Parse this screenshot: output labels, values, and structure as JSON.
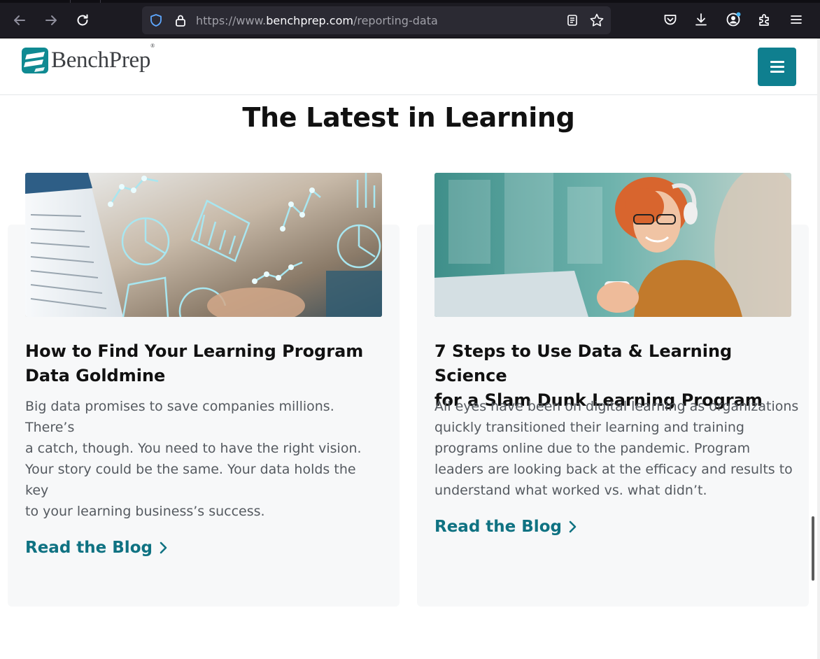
{
  "browser": {
    "url_prefix": "https://www.",
    "url_host": "benchprep.com",
    "url_path": "/reporting-data",
    "icons": [
      "back-icon",
      "forward-icon",
      "reload-icon",
      "shield-icon",
      "lock-icon",
      "reader-view-icon",
      "bookmark-star-icon",
      "pocket-icon",
      "download-icon",
      "account-icon",
      "extensions-icon",
      "hamburger-menu-icon"
    ]
  },
  "site": {
    "logo_text": "BenchPrep",
    "logo_registered": "®",
    "brand_color": "#0f7f8f",
    "link_color": "#0f7282"
  },
  "main": {
    "section_title": "The Latest in Learning",
    "cards": [
      {
        "title_line1": "How to Find Your Learning Program",
        "title_line2": "Data Goldmine",
        "body_lines": [
          "Big data promises to save companies millions. There’s",
          "a catch, though. You need to have the right vision.",
          "Your story could be the same. Your data holds the key",
          "to your learning business’s success."
        ],
        "link_label": "Read the Blog"
      },
      {
        "title_line1": "7 Steps to Use Data & Learning Science",
        "title_line2": "for a Slam Dunk Learning Program",
        "body_lines": [
          "All eyes have been on digital learning as organizations",
          "quickly transitioned their learning and training",
          "programs online due to the pandemic. Program",
          "leaders are looking back at the efficacy and results to",
          "understand what worked vs. what didn’t."
        ],
        "link_label": "Read the Blog"
      }
    ]
  }
}
